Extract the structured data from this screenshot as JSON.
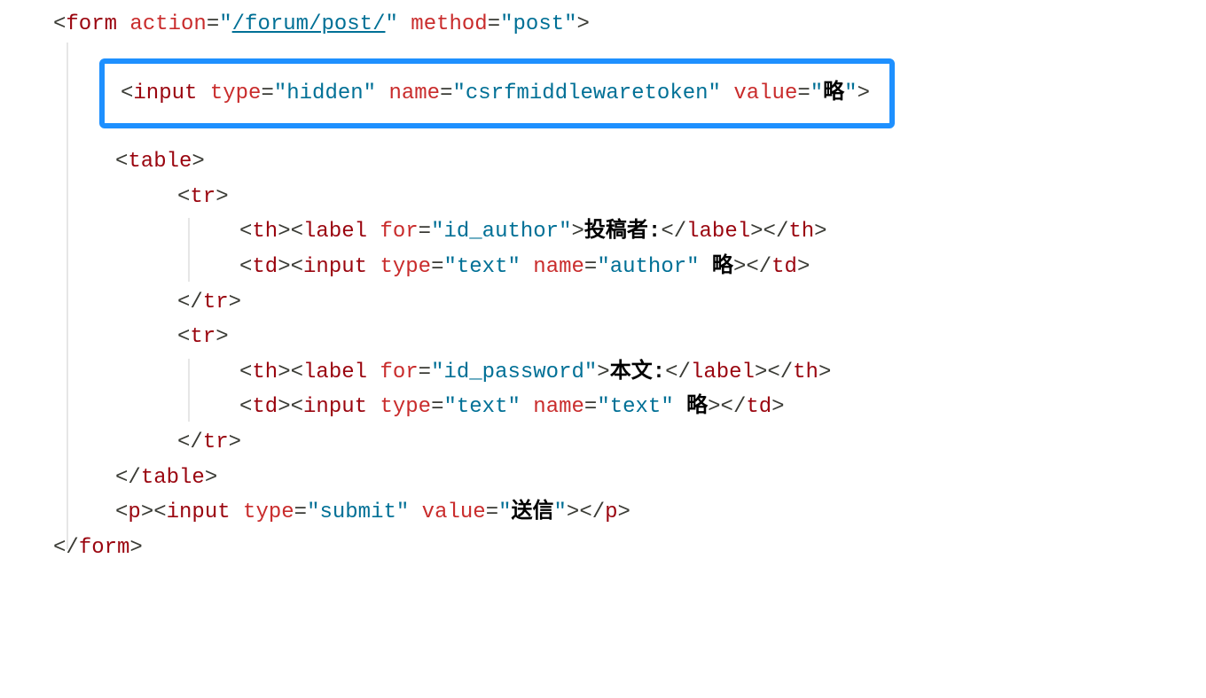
{
  "code": {
    "form_open": {
      "punct1": "<",
      "tag": "form",
      "action_attr": " action",
      "eq1": "=",
      "action_q1": "\"",
      "action_val": "/forum/post/",
      "action_q2": "\"",
      "method_attr": " method",
      "eq2": "=",
      "method_val": "\"post\"",
      "punct2": ">"
    },
    "hidden_input": {
      "punct1": "<",
      "tag": "input",
      "type_attr": " type",
      "eq1": "=",
      "type_val": "\"hidden\"",
      "name_attr": " name",
      "eq2": "=",
      "name_val": "\"csrfmiddlewaretoken\"",
      "value_attr": " value",
      "eq3": "=",
      "value_q1": "\"",
      "value_val": "略",
      "value_q2": "\"",
      "punct2": ">"
    },
    "table_open": {
      "punct1": "<",
      "tag": "table",
      "punct2": ">"
    },
    "tr1_open": {
      "punct1": "<",
      "tag": "tr",
      "punct2": ">"
    },
    "tr1_th": {
      "punct1": "<",
      "th": "th",
      "punct2": "><",
      "label": "label",
      "for_attr": " for",
      "eq": "=",
      "for_val": "\"id_author\"",
      "punct3": ">",
      "text": "投稿者:",
      "punct4": "</",
      "label2": "label",
      "punct5": "></",
      "th2": "th",
      "punct6": ">"
    },
    "tr1_td": {
      "punct1": "<",
      "td": "td",
      "punct2": "><",
      "input": "input",
      "type_attr": " type",
      "eq1": "=",
      "type_val": "\"text\"",
      "name_attr": " name",
      "eq2": "=",
      "name_val": "\"author\"",
      "extra": " 略",
      "punct3": "></",
      "td2": "td",
      "punct4": ">"
    },
    "tr1_close": {
      "punct1": "</",
      "tag": "tr",
      "punct2": ">"
    },
    "tr2_open": {
      "punct1": "<",
      "tag": "tr",
      "punct2": ">"
    },
    "tr2_th": {
      "punct1": "<",
      "th": "th",
      "punct2": "><",
      "label": "label",
      "for_attr": " for",
      "eq": "=",
      "for_val": "\"id_password\"",
      "punct3": ">",
      "text": "本文:",
      "punct4": "</",
      "label2": "label",
      "punct5": "></",
      "th2": "th",
      "punct6": ">"
    },
    "tr2_td": {
      "punct1": "<",
      "td": "td",
      "punct2": "><",
      "input": "input",
      "type_attr": " type",
      "eq1": "=",
      "type_val": "\"text\"",
      "name_attr": " name",
      "eq2": "=",
      "name_val": "\"text\"",
      "extra": " 略",
      "punct3": "></",
      "td2": "td",
      "punct4": ">"
    },
    "tr2_close": {
      "punct1": "</",
      "tag": "tr",
      "punct2": ">"
    },
    "table_close": {
      "punct1": "</",
      "tag": "table",
      "punct2": ">"
    },
    "p_line": {
      "punct1": "<",
      "p": "p",
      "punct2": "><",
      "input": "input",
      "type_attr": " type",
      "eq1": "=",
      "type_val": "\"submit\"",
      "value_attr": " value",
      "eq2": "=",
      "value_q1": "\"",
      "value_val": "送信",
      "value_q2": "\"",
      "punct3": "></",
      "p2": "p",
      "punct4": ">"
    },
    "form_close": {
      "punct1": "</",
      "tag": "form",
      "punct2": ">"
    }
  }
}
